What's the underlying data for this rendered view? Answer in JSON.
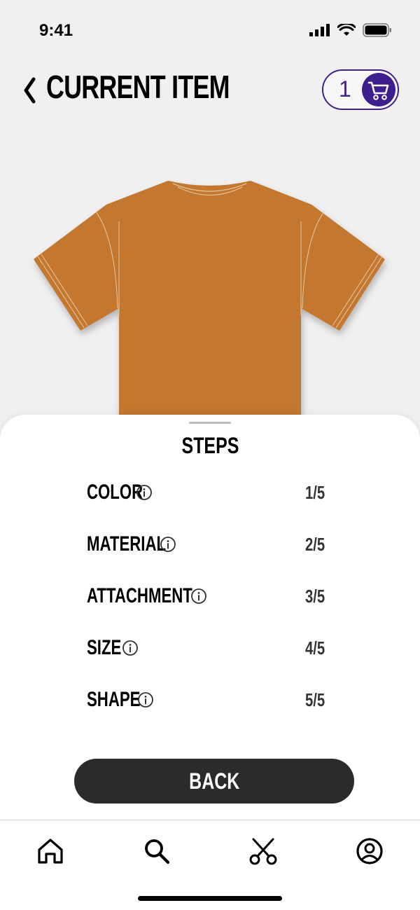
{
  "status_bar": {
    "time": "9:41",
    "icons": [
      "signal-icon",
      "wifi-icon",
      "battery-icon"
    ]
  },
  "header": {
    "back_icon": "chevron-left-icon",
    "title": "CURRENT ITEM",
    "cart": {
      "count": "1",
      "icon": "cart-icon"
    }
  },
  "product": {
    "image": "t-shirt",
    "color": "#c4772f"
  },
  "steps": {
    "title": "STEPS",
    "items": [
      {
        "label": "COLOR",
        "progress": "1/5"
      },
      {
        "label": "MATERIAL",
        "progress": "2/5"
      },
      {
        "label": "ATTACHMENT",
        "progress": "3/5"
      },
      {
        "label": "SIZE",
        "progress": "4/5"
      },
      {
        "label": "SHAPE",
        "progress": "5/5"
      }
    ],
    "back_label": "BACK"
  },
  "bottom_nav": {
    "items": [
      "home-icon",
      "search-icon",
      "scissors-icon",
      "profile-icon"
    ]
  },
  "colors": {
    "accent": "#3f1f8f",
    "button": "#2b2b2b",
    "background": "#f0f0f0"
  }
}
